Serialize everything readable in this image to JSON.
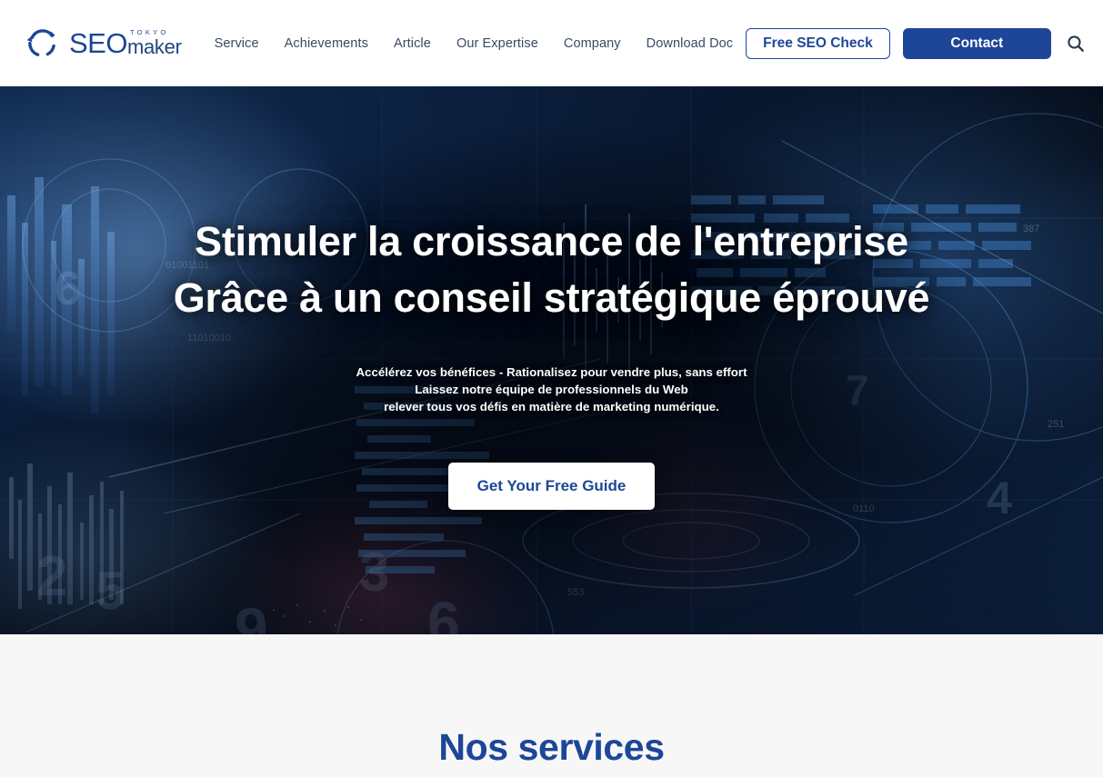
{
  "brand": {
    "logo_icon": "circular-swirl-logo-icon",
    "seo": "SEO",
    "tokyo": "TOKYO",
    "maker": "maker"
  },
  "nav": {
    "items": [
      {
        "label": "Service"
      },
      {
        "label": "Achievements"
      },
      {
        "label": "Article"
      },
      {
        "label": "Our Expertise"
      },
      {
        "label": "Company"
      },
      {
        "label": "Download Doc"
      }
    ],
    "free_check_label": "Free SEO Check",
    "contact_label": "Contact",
    "search_icon": "search-icon",
    "language_icon": "globe-icon"
  },
  "hero": {
    "title_line1": "Stimuler la croissance de l'entreprise",
    "title_line2": "Grâce à un conseil stratégique éprouvé",
    "sub_line1": "Accélérez vos bénéfices - Rationalisez pour vendre plus, sans effort",
    "sub_line2": "Laissez notre équipe de professionnels du Web",
    "sub_line3": "relever tous vos défis en matière de marketing numérique.",
    "cta_label": "Get Your Free Guide"
  },
  "services": {
    "title": "Nos services"
  },
  "colors": {
    "brand_blue": "#1d4698",
    "nav_text": "#3b4a63",
    "hero_dark": "#060c18",
    "section_bg": "#f7f7f8",
    "white": "#ffffff"
  }
}
